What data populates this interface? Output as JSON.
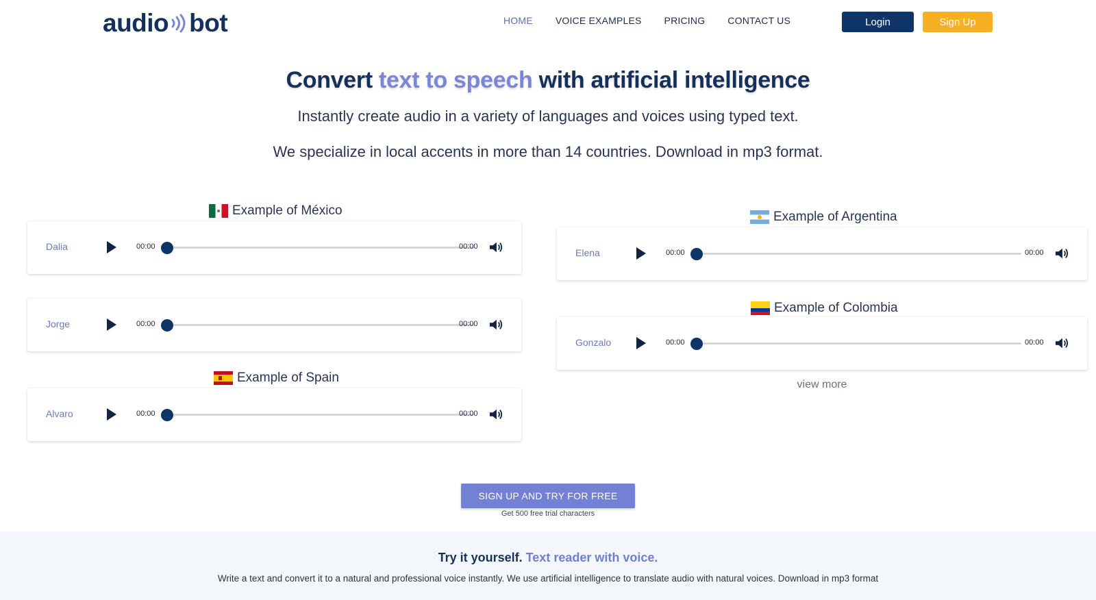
{
  "header": {
    "logo_left": "audio",
    "logo_right": "bot",
    "nav": [
      {
        "label": "HOME",
        "active": true
      },
      {
        "label": "VOICE EXAMPLES",
        "active": false
      },
      {
        "label": "PRICING",
        "active": false
      },
      {
        "label": "CONTACT US",
        "active": false
      }
    ],
    "login_label": "Login",
    "signup_label": "Sign Up"
  },
  "hero": {
    "title_part1": "Convert ",
    "title_accent": "text to speech",
    "title_part2": " with artificial intelligence",
    "subtitle1": "Instantly create audio in a variety of languages and voices using typed text.",
    "subtitle2": "We specialize in local accents in more than 14 countries. Download in mp3 format."
  },
  "examples": {
    "mexico": {
      "heading": "Example of México",
      "flag_icon": "mexico-flag-icon"
    },
    "argentina": {
      "heading": "Example of Argentina",
      "flag_icon": "argentina-flag-icon"
    },
    "spain": {
      "heading": "Example of Spain",
      "flag_icon": "spain-flag-icon"
    },
    "colombia": {
      "heading": "Example of Colombia",
      "flag_icon": "colombia-flag-icon"
    }
  },
  "players": {
    "dalia": {
      "name": "Dalia",
      "current": "00:00",
      "duration": "00:00",
      "progress": 0
    },
    "jorge": {
      "name": "Jorge",
      "current": "00:00",
      "duration": "00:00",
      "progress": 0
    },
    "alvaro": {
      "name": "Alvaro",
      "current": "00:00",
      "duration": "00:00",
      "progress": 0
    },
    "elena": {
      "name": "Elena",
      "current": "00:00",
      "duration": "00:00",
      "progress": 0
    },
    "gonzalo": {
      "name": "Gonzalo",
      "current": "00:00",
      "duration": "00:00",
      "progress": 0
    }
  },
  "view_more_label": "view more",
  "cta": {
    "button_label": "SIGN UP AND TRY FOR FREE",
    "note": "Get 500 free trial characters"
  },
  "bottom": {
    "title_part1": "Try it yourself. ",
    "title_accent": "Text reader with voice.",
    "description": "Write a text and convert it to a natural and professional voice instantly. We use artificial intelligence to translate audio with natural voices. Download in mp3 format"
  },
  "colors": {
    "brand_navy": "#0f3468",
    "brand_accent": "#7b86d6",
    "signup_orange": "#f7b024",
    "cta_purple": "#7381d4"
  }
}
